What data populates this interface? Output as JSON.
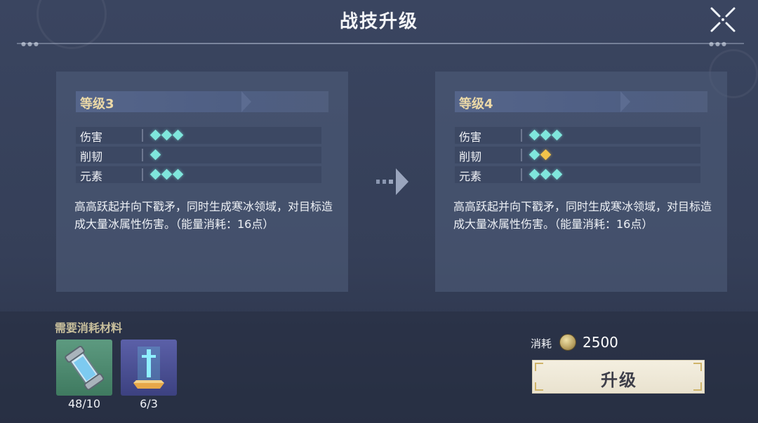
{
  "header": {
    "title": "战技升级",
    "close_icon": "close-x-icon"
  },
  "current": {
    "level_label": "等级3",
    "stats": [
      {
        "name": "伤害",
        "filled": 3,
        "gold": 0
      },
      {
        "name": "削韧",
        "filled": 1,
        "gold": 0
      },
      {
        "name": "元素",
        "filled": 3,
        "gold": 0
      }
    ],
    "description": "高高跃起并向下戳矛，同时生成寒冰领域，对目标造成大量冰属性伤害。（能量消耗：16点）"
  },
  "next": {
    "level_label": "等级4",
    "stats": [
      {
        "name": "伤害",
        "filled": 3,
        "gold": 0
      },
      {
        "name": "削韧",
        "filled": 1,
        "gold": 1
      },
      {
        "name": "元素",
        "filled": 3,
        "gold": 0
      }
    ],
    "description": "高高跃起并向下戳矛，同时生成寒冰领域，对目标造成大量冰属性伤害。（能量消耗：16点）"
  },
  "materials": {
    "title": "需要消耗材料",
    "items": [
      {
        "icon": "ice-canister-icon",
        "count": "48/10"
      },
      {
        "icon": "crystal-sword-icon",
        "count": "6/3"
      }
    ]
  },
  "cost": {
    "label": "消耗",
    "icon": "coin-icon",
    "value": "2500"
  },
  "upgrade_button": {
    "label": "升级"
  },
  "colors": {
    "diamond": "#7fe6dc",
    "diamond_gold": "#f2c34a",
    "level_text": "#ecd9a7",
    "accent_gold": "#cfb46a"
  }
}
